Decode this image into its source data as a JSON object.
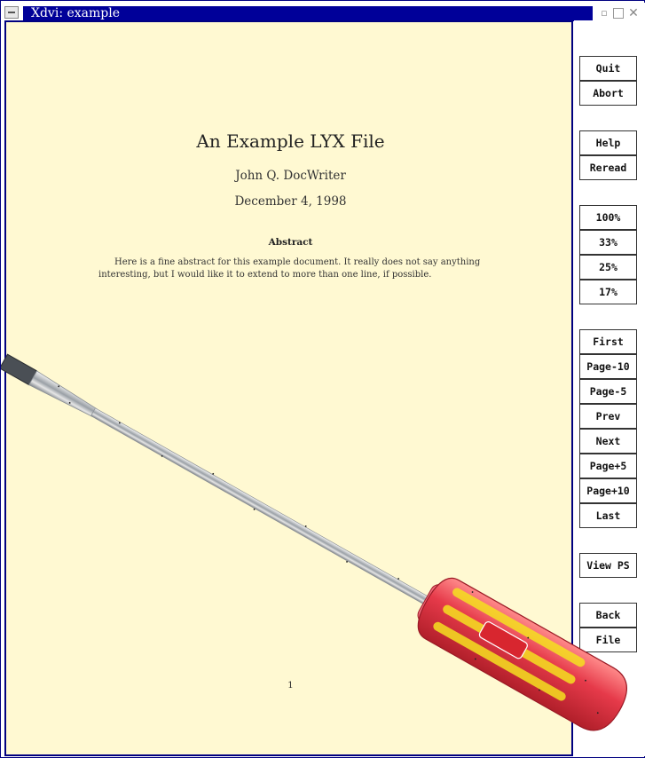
{
  "window": {
    "title": "Xdvi:  example"
  },
  "document": {
    "title": "An Example LYX File",
    "author": "John Q. DocWriter",
    "date": "December 4, 1998",
    "abstract_heading": "Abstract",
    "abstract_text": "Here is a fine abstract for this example document. It really does not say anything interesting, but I would like it to extend to more than one line, if possible.",
    "page_number": "1",
    "background_color": "#fff9d2"
  },
  "panel": {
    "buttons": {
      "quit": "Quit",
      "abort": "Abort",
      "help": "Help",
      "reread": "Reread",
      "zoom100": "100%",
      "zoom33": "33%",
      "zoom25": "25%",
      "zoom17": "17%",
      "first": "First",
      "page_minus10": "Page-10",
      "page_minus5": "Page-5",
      "prev": "Prev",
      "next": "Next",
      "page_plus5": "Page+5",
      "page_plus10": "Page+10",
      "last": "Last",
      "view_ps": "View PS",
      "back": "Back",
      "file": "File"
    }
  },
  "decoration": {
    "screwdriver_handle_color": "#e63a4a",
    "screwdriver_accent_color": "#f5e020"
  }
}
